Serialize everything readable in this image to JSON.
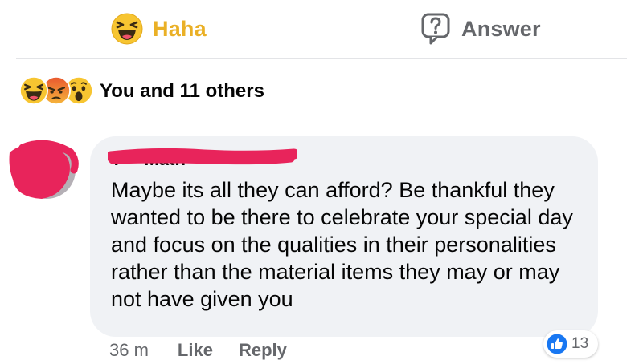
{
  "actions": {
    "haha_label": "Haha",
    "answer_label": "Answer"
  },
  "reactions": {
    "icons": [
      "haha-icon",
      "angry-icon",
      "wow-icon"
    ],
    "summary": "You and 11 others"
  },
  "comment": {
    "author": "T— Math",
    "text": "Maybe its all they can afford? Be thankful they wanted to be there to celebrate your special day and focus on the qualities in their personalities rather than the material items they may or may not have given you",
    "timestamp": "36 m",
    "like_label": "Like",
    "reply_label": "Reply",
    "like_count": "13"
  },
  "colors": {
    "haha_accent": "#eab026",
    "secondary_text": "#65676b",
    "bubble_bg": "#f0f2f5",
    "like_blue": "#1877f2",
    "redaction_pink": "#e8245b"
  }
}
